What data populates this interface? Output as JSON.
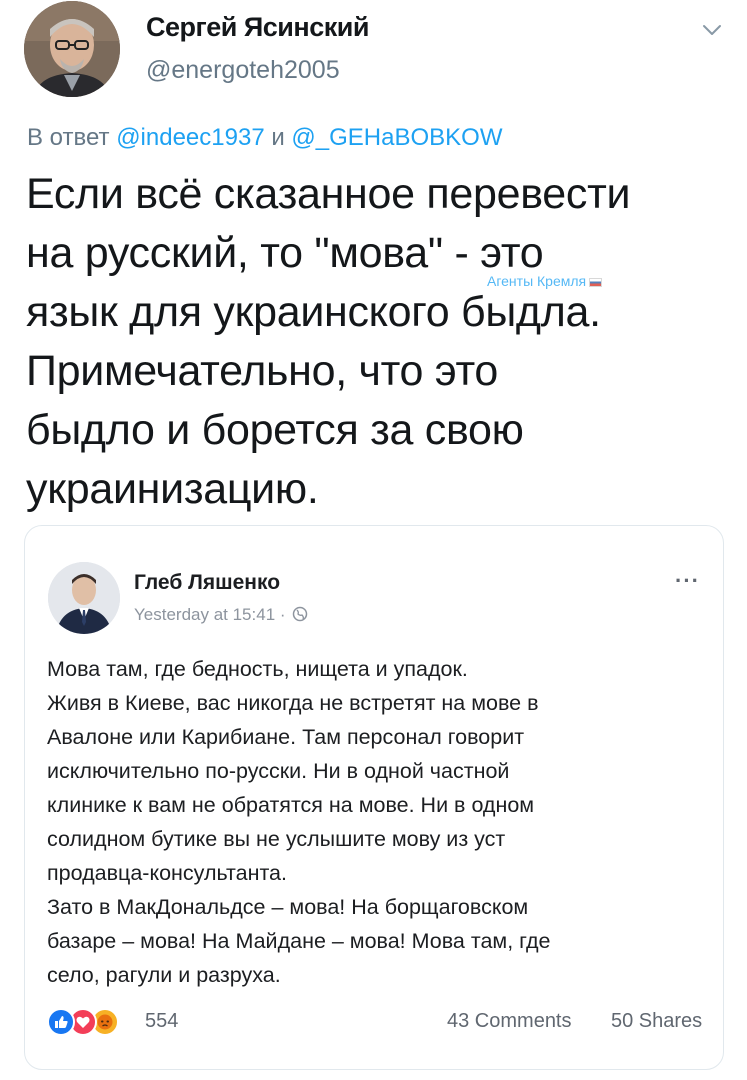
{
  "author": {
    "name": "Сергей Ясинский",
    "handle": "@energoteh2005"
  },
  "reply": {
    "prefix": "В ответ",
    "mention1": "@indeec1937",
    "conjunction": "и",
    "mention2": "@_GEHaBOBKOW"
  },
  "tweet_text": [
    "Если всё сказанное перевести",
    "на русский, то \"мова\" - это",
    "язык для украинского быдла.",
    "Примечательно, что это",
    "быдло и борется за свою",
    "украинизацию."
  ],
  "watermark": "Агенты Кремля",
  "quoted_post": {
    "author": "Глеб Ляшенко",
    "time": "Yesterday at 15:41 ·",
    "more_label": "···",
    "lines": [
      "Мова там, где бедность, нищета и упадок.",
      "Живя в Киеве, вас никогда не встретят на мове в",
      "Авалоне или Карибиане. Там персонал говорит",
      "исключительно по-русски. Ни в одной частной",
      "клинике к вам не обратятся на мове. Ни в одном",
      "солидном бутике вы не услышите мову из уст",
      "продавца-консультанта.",
      "Зато в МакДональдсе – мова! На борщаговском",
      "базаре – мова! На Майдане – мова! Мова там, где",
      "село, рагули и разруха."
    ],
    "reactions_count": "554",
    "comments": "43 Comments",
    "shares": "50 Shares"
  },
  "colors": {
    "accent": "#1da1f2",
    "secondary_text": "#657786",
    "fb_like": "#1877f2",
    "fb_love": "#f33e58",
    "fb_angry": "#f7b125"
  }
}
